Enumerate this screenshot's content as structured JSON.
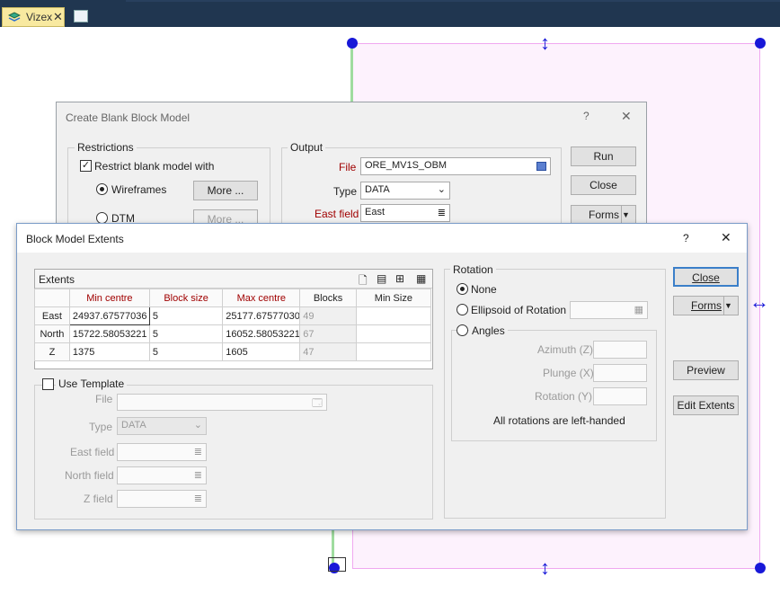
{
  "topbar": {
    "tab_label": "Vizex",
    "tab_close": "✕"
  },
  "colors": {
    "handle": "#1818d8",
    "accent": "#203650",
    "required": "#a00000"
  },
  "back_dialog": {
    "title": "Create Blank Block Model",
    "help": "?",
    "close_x": "✕",
    "restrictions": {
      "group_label": "Restrictions",
      "restrict_label": "Restrict blank model with",
      "wireframes_label": "Wireframes",
      "dtm_label": "DTM",
      "more_button": "More ...",
      "more_button_2": "More ..."
    },
    "output": {
      "group_label": "Output",
      "file_label": "File",
      "file_value": "ORE_MV1S_OBM",
      "type_label": "Type",
      "type_value": "DATA",
      "east_label": "East field",
      "east_value": "East"
    },
    "buttons": {
      "run": "Run",
      "close": "Close",
      "forms": "Forms"
    }
  },
  "front_dialog": {
    "title": "Block Model Extents",
    "help": "?",
    "close_x": "✕",
    "extents": {
      "label": "Extents",
      "columns": [
        "Min centre",
        "Block size",
        "Max centre",
        "Blocks",
        "Min Size"
      ],
      "rows": [
        {
          "name": "East",
          "min": "24937.67577036",
          "size": "5",
          "max": "25177.67577030",
          "blocks": "49",
          "minsize": ""
        },
        {
          "name": "North",
          "min": "15722.58053221",
          "size": "5",
          "max": "16052.58053221",
          "blocks": "67",
          "minsize": ""
        },
        {
          "name": "Z",
          "min": "1375",
          "size": "5",
          "max": "1605",
          "blocks": "47",
          "minsize": ""
        }
      ]
    },
    "template": {
      "label": "Use Template",
      "file_label": "File",
      "type_label": "Type",
      "type_value": "DATA",
      "east_label": "East field",
      "north_label": "North field",
      "z_label": "Z field"
    },
    "rotation": {
      "label": "Rotation",
      "none": "None",
      "ellipsoid": "Ellipsoid of Rotation",
      "angles": "Angles",
      "azimuth": "Azimuth (Z)",
      "plunge": "Plunge (X)",
      "rotation": "Rotation (Y)",
      "note": "All rotations are left-handed"
    },
    "buttons": {
      "close": "Close",
      "forms": "Forms",
      "preview": "Preview",
      "edit_extents": "Edit Extents"
    }
  }
}
